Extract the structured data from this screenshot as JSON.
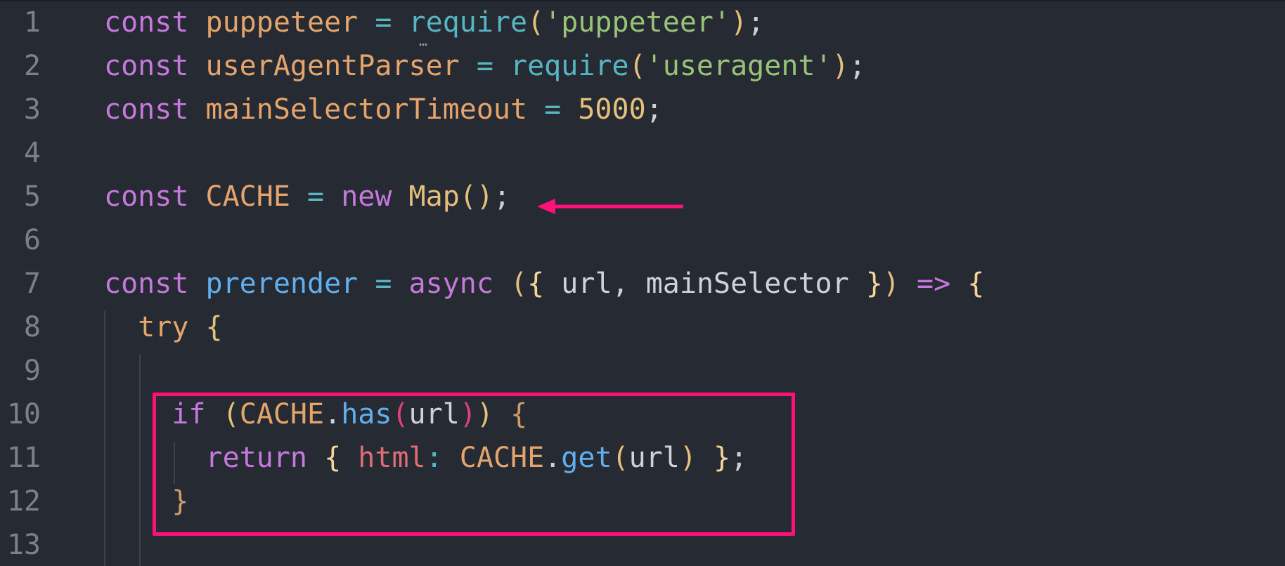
{
  "editor": {
    "language": "javascript",
    "lines": [
      {
        "number": "1",
        "tokens": [
          {
            "t": "const",
            "c": "kw"
          },
          {
            "t": " ",
            "c": "plain"
          },
          {
            "t": "puppeteer",
            "c": "var"
          },
          {
            "t": " = ",
            "c": "op"
          },
          {
            "t": "require",
            "c": "op"
          },
          {
            "t": "(",
            "c": "paren"
          },
          {
            "t": "'puppeteer'",
            "c": "str"
          },
          {
            "t": ")",
            "c": "paren"
          },
          {
            "t": ";",
            "c": "punc"
          }
        ]
      },
      {
        "number": "2",
        "tokens": [
          {
            "t": "const",
            "c": "kw"
          },
          {
            "t": " ",
            "c": "plain"
          },
          {
            "t": "userAgentParser",
            "c": "var"
          },
          {
            "t": " = ",
            "c": "op"
          },
          {
            "t": "require",
            "c": "op"
          },
          {
            "t": "(",
            "c": "paren"
          },
          {
            "t": "'useragent'",
            "c": "str"
          },
          {
            "t": ")",
            "c": "paren"
          },
          {
            "t": ";",
            "c": "punc"
          }
        ]
      },
      {
        "number": "3",
        "tokens": [
          {
            "t": "const",
            "c": "kw"
          },
          {
            "t": " ",
            "c": "plain"
          },
          {
            "t": "mainSelectorTimeout",
            "c": "var"
          },
          {
            "t": " = ",
            "c": "op"
          },
          {
            "t": "5000",
            "c": "num"
          },
          {
            "t": ";",
            "c": "punc"
          }
        ]
      },
      {
        "number": "4",
        "tokens": []
      },
      {
        "number": "5",
        "tokens": [
          {
            "t": "const",
            "c": "kw"
          },
          {
            "t": " ",
            "c": "plain"
          },
          {
            "t": "CACHE",
            "c": "var"
          },
          {
            "t": " = ",
            "c": "op"
          },
          {
            "t": "new",
            "c": "kw"
          },
          {
            "t": " ",
            "c": "plain"
          },
          {
            "t": "Map",
            "c": "cls"
          },
          {
            "t": "()",
            "c": "paren"
          },
          {
            "t": ";",
            "c": "punc"
          }
        ]
      },
      {
        "number": "6",
        "tokens": []
      },
      {
        "number": "7",
        "tokens": [
          {
            "t": "const",
            "c": "kw"
          },
          {
            "t": " ",
            "c": "plain"
          },
          {
            "t": "prerender",
            "c": "fn"
          },
          {
            "t": " = ",
            "c": "op"
          },
          {
            "t": "async",
            "c": "kw"
          },
          {
            "t": " ",
            "c": "plain"
          },
          {
            "t": "(",
            "c": "paren"
          },
          {
            "t": "{",
            "c": "brace-y"
          },
          {
            "t": " url, mainSelector ",
            "c": "plain"
          },
          {
            "t": "}",
            "c": "brace-y"
          },
          {
            "t": ")",
            "c": "paren"
          },
          {
            "t": " => ",
            "c": "kw"
          },
          {
            "t": "{",
            "c": "brace-y"
          }
        ]
      },
      {
        "number": "8",
        "tokens": [
          {
            "t": "  ",
            "c": "plain"
          },
          {
            "t": "try",
            "c": "var"
          },
          {
            "t": " ",
            "c": "plain"
          },
          {
            "t": "{",
            "c": "paren"
          }
        ]
      },
      {
        "number": "9",
        "tokens": []
      },
      {
        "number": "10",
        "tokens": [
          {
            "t": "    ",
            "c": "plain"
          },
          {
            "t": "if",
            "c": "kw"
          },
          {
            "t": " ",
            "c": "plain"
          },
          {
            "t": "(",
            "c": "paren"
          },
          {
            "t": "CACHE",
            "c": "var"
          },
          {
            "t": ".",
            "c": "punc"
          },
          {
            "t": "has",
            "c": "fn"
          },
          {
            "t": "(",
            "c": "paren-r"
          },
          {
            "t": "url",
            "c": "plain"
          },
          {
            "t": ")",
            "c": "paren-r"
          },
          {
            "t": ")",
            "c": "paren"
          },
          {
            "t": " ",
            "c": "plain"
          },
          {
            "t": "{",
            "c": "brace-o"
          }
        ]
      },
      {
        "number": "11",
        "tokens": [
          {
            "t": "      ",
            "c": "plain"
          },
          {
            "t": "return",
            "c": "kw"
          },
          {
            "t": " ",
            "c": "plain"
          },
          {
            "t": "{",
            "c": "brace-y"
          },
          {
            "t": " ",
            "c": "plain"
          },
          {
            "t": "html",
            "c": "prop"
          },
          {
            "t": ": ",
            "c": "op"
          },
          {
            "t": "CACHE",
            "c": "var"
          },
          {
            "t": ".",
            "c": "punc"
          },
          {
            "t": "get",
            "c": "fn"
          },
          {
            "t": "(",
            "c": "paren"
          },
          {
            "t": "url",
            "c": "plain"
          },
          {
            "t": ")",
            "c": "paren"
          },
          {
            "t": " ",
            "c": "plain"
          },
          {
            "t": "}",
            "c": "brace-y"
          },
          {
            "t": ";",
            "c": "punc"
          }
        ]
      },
      {
        "number": "12",
        "tokens": [
          {
            "t": "    ",
            "c": "plain"
          },
          {
            "t": "}",
            "c": "brace-o"
          }
        ]
      },
      {
        "number": "13",
        "tokens": []
      }
    ]
  },
  "annotations": {
    "highlight_color": "#ff1177",
    "arrow_color": "#ff1177"
  }
}
